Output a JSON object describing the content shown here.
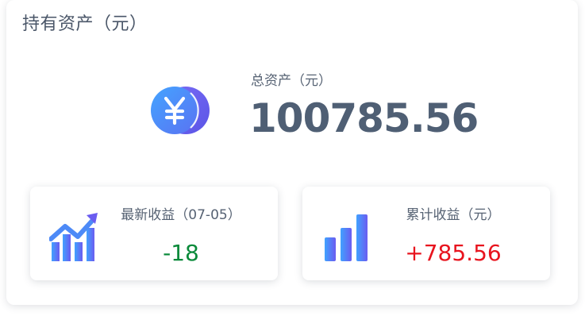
{
  "holdings": {
    "title": "持有资产（元）",
    "total_label": "总资产（元）",
    "total_value": "100785.56"
  },
  "latest_income": {
    "label": "最新收益（07-05）",
    "value": "-18",
    "icon": "trend-up-chart-icon",
    "value_color": "#0a8a3a"
  },
  "cumulative_income": {
    "label": "累计收益（元）",
    "value": "+785.56",
    "icon": "bar-chart-icon",
    "value_color": "#e8141e"
  },
  "colors": {
    "accent_blue": "#3f8cff",
    "accent_purple": "#6a5cf0",
    "text_primary": "#4f5f74"
  }
}
